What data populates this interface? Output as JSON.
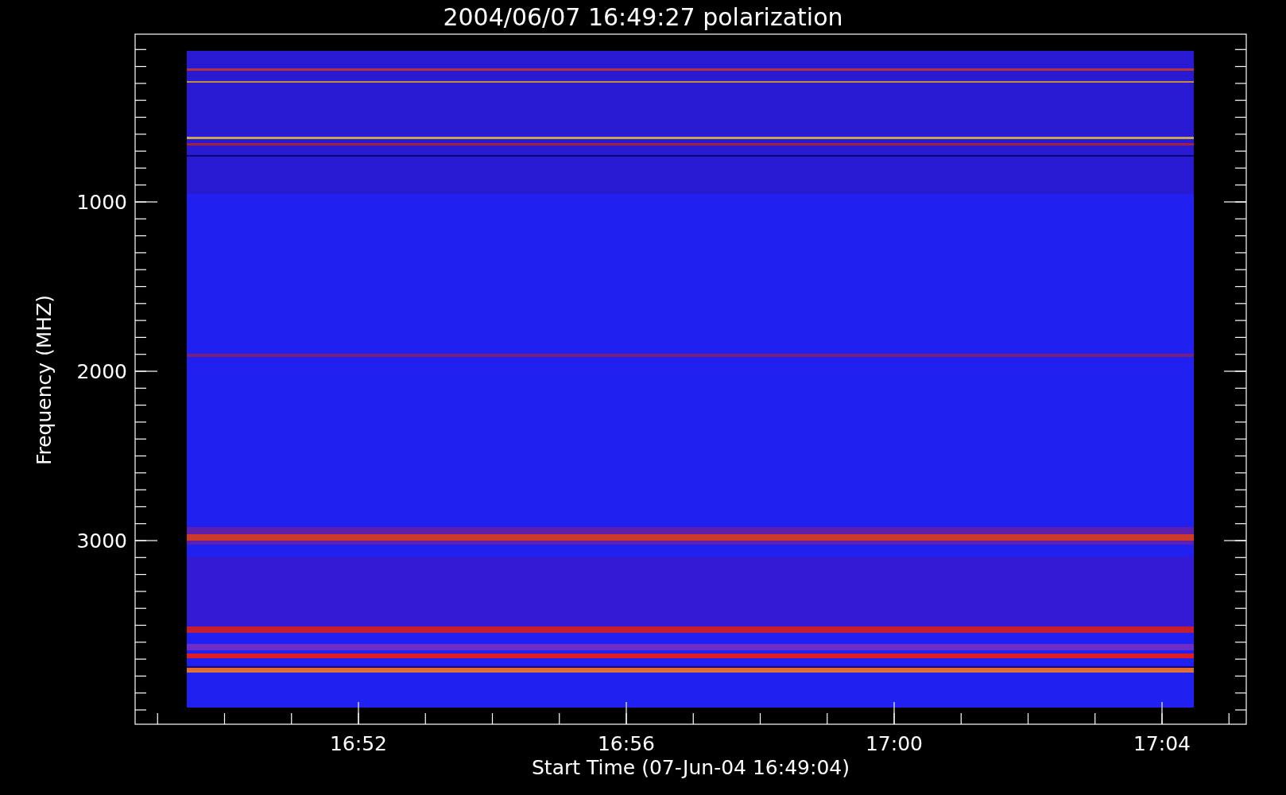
{
  "title": "2004/06/07 16:49:27 polarization",
  "y_axis": {
    "label": "Frequency (MHZ)",
    "ticks": [
      "1000",
      "2000",
      "3000"
    ]
  },
  "x_axis": {
    "label": "Start Time (07-Jun-04 16:49:04)",
    "ticks": [
      "16:52",
      "16:56",
      "17:00",
      "17:04"
    ]
  }
}
